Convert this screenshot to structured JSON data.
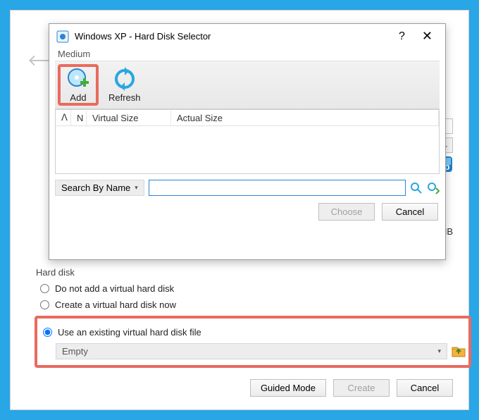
{
  "modal": {
    "title": "Windows XP - Hard Disk Selector",
    "help": "?",
    "close": "✕",
    "subtitle": "Medium",
    "toolbar": {
      "add": "Add",
      "refresh": "Refresh"
    },
    "columns": {
      "sort": "ᐱ",
      "name": "N",
      "vsize": "Virtual Size",
      "asize": "Actual Size"
    },
    "search_label": "Search By Name",
    "search_value": "",
    "choose": "Choose",
    "cancel": "Cancel"
  },
  "hard_disk": {
    "legend": "Hard disk",
    "opt_none": "Do not add a virtual hard disk",
    "opt_create": "Create a virtual hard disk now",
    "opt_use": "Use an existing virtual hard disk file",
    "dropdown_value": "Empty"
  },
  "footer": {
    "guided": "Guided Mode",
    "create": "Create",
    "cancel": "Cancel"
  },
  "side": {
    "mb": "MB"
  }
}
